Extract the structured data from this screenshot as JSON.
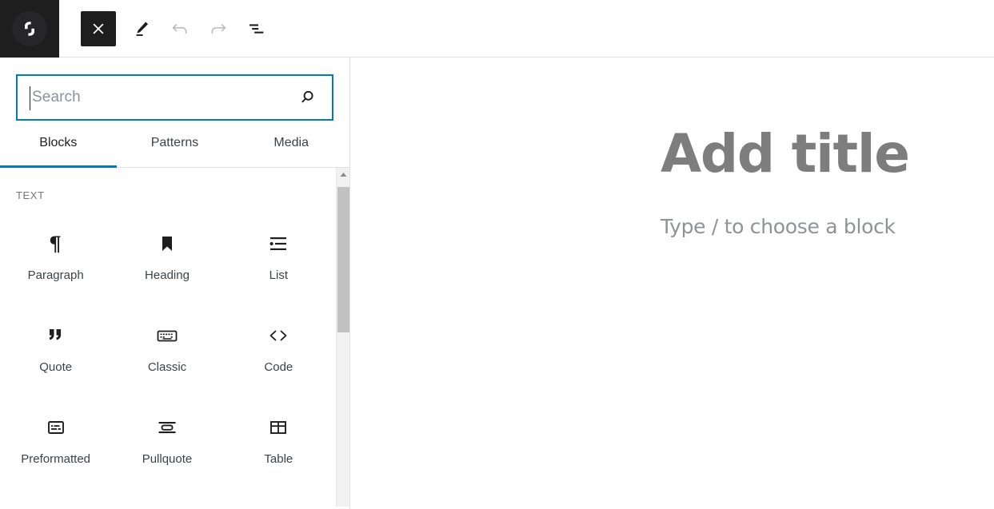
{
  "header": {
    "logo": {
      "name": "site-logo",
      "glyph": "gutenberg-mark"
    },
    "toolbar": [
      {
        "id": "close-inserter",
        "label": "Close block inserter",
        "icon": "close-icon",
        "state": "active"
      },
      {
        "id": "tools",
        "label": "Tools",
        "icon": "pencil-icon",
        "state": "default"
      },
      {
        "id": "undo",
        "label": "Undo",
        "icon": "undo-icon",
        "state": "disabled"
      },
      {
        "id": "redo",
        "label": "Redo",
        "icon": "redo-icon",
        "state": "disabled"
      },
      {
        "id": "details",
        "label": "Details",
        "icon": "document-outline-icon",
        "state": "default"
      }
    ]
  },
  "inserter": {
    "search": {
      "value": "",
      "placeholder": "Search",
      "icon": "search-icon"
    },
    "tabs": [
      {
        "label": "Blocks",
        "active": true
      },
      {
        "label": "Patterns",
        "active": false
      },
      {
        "label": "Media",
        "active": false
      }
    ],
    "category": "TEXT",
    "blocks": [
      {
        "label": "Paragraph",
        "icon": "paragraph-icon"
      },
      {
        "label": "Heading",
        "icon": "heading-icon"
      },
      {
        "label": "List",
        "icon": "list-icon"
      },
      {
        "label": "Quote",
        "icon": "quote-icon"
      },
      {
        "label": "Classic",
        "icon": "classic-icon"
      },
      {
        "label": "Code",
        "icon": "code-icon"
      },
      {
        "label": "Preformatted",
        "icon": "preformatted-icon"
      },
      {
        "label": "Pullquote",
        "icon": "pullquote-icon"
      },
      {
        "label": "Table",
        "icon": "table-icon"
      }
    ],
    "scrollbar": {
      "arrow_up": "chevron-up-icon"
    }
  },
  "canvas": {
    "title_placeholder": "Add title",
    "body_placeholder": "Type / to choose a block"
  },
  "colors": {
    "accent": "#007cba",
    "dark": "#1e1e1e",
    "text": "#3c434a",
    "muted": "#757575",
    "placeholder": "#8f9296",
    "title_placeholder": "#7d7d7d",
    "border": "#e0e0e0",
    "scroll_thumb": "#c1c1c1",
    "scroll_track": "#f1f1f1"
  }
}
